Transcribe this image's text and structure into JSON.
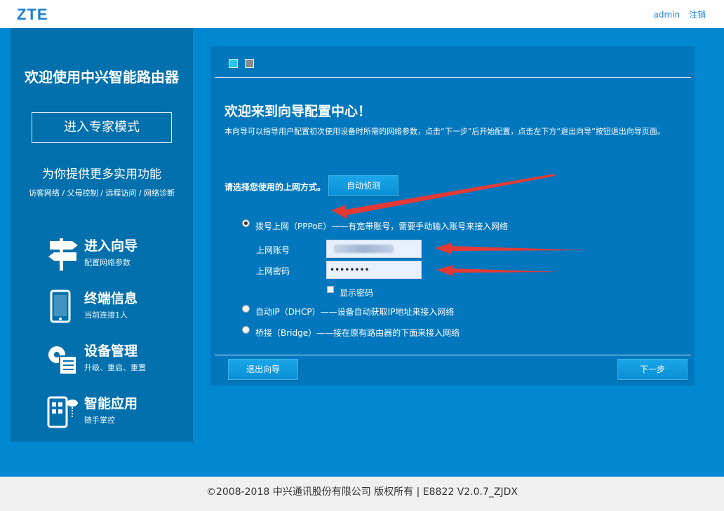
{
  "header": {
    "logo": "ZTE",
    "user": "admin",
    "logout": "注销"
  },
  "sidebar": {
    "title": "欢迎使用中兴智能路由器",
    "expert_button": "进入专家模式",
    "subtitle": "为你提供更多实用功能",
    "features": "访客网络 / 父母控制 / 远程访问 / 网络诊断",
    "menu": [
      {
        "title": "进入向导",
        "desc": "配置网络参数",
        "icon": "signpost-icon"
      },
      {
        "title": "终端信息",
        "desc": "当前连接1人",
        "icon": "phone-icon"
      },
      {
        "title": "设备管理",
        "desc": "升级、重启、重置",
        "icon": "gear-checklist-icon"
      },
      {
        "title": "智能应用",
        "desc": "随手掌控",
        "icon": "smart-app-icon"
      }
    ]
  },
  "wizard": {
    "title": "欢迎来到向导配置中心！",
    "description": "本向导可以指导用户配置初次使用设备时所需的网络参数，点击“下一步”后开始配置，点击左下方“退出向导”按钮退出向导页面。",
    "choose_label": "请选择您使用的上网方式。",
    "auto_detect": "自动侦测",
    "options": [
      {
        "label": "拨号上网（PPPoE）——有宽带账号，需要手动输入账号来接入网络",
        "checked": true
      },
      {
        "label": "自动IP（DHCP）——设备自动获取IP地址来接入网络",
        "checked": false
      },
      {
        "label": "桥接（Bridge）——接在原有路由器的下面来接入网络",
        "checked": false
      }
    ],
    "account_label": "上网账号",
    "account_value": "",
    "password_label": "上网密码",
    "password_value": "••••••••",
    "show_password": "显示密码",
    "exit_button": "退出向导",
    "next_button": "下一步"
  },
  "footer": {
    "text": "©2008-2018 中兴通讯股份有限公司 版权所有  |   E8822 V2.0.7_ZJDX"
  },
  "colors": {
    "page": "#0288d1",
    "sidebar": "#0270ad",
    "panel": "#0277bd",
    "annotation_arrow": "#e53935"
  }
}
